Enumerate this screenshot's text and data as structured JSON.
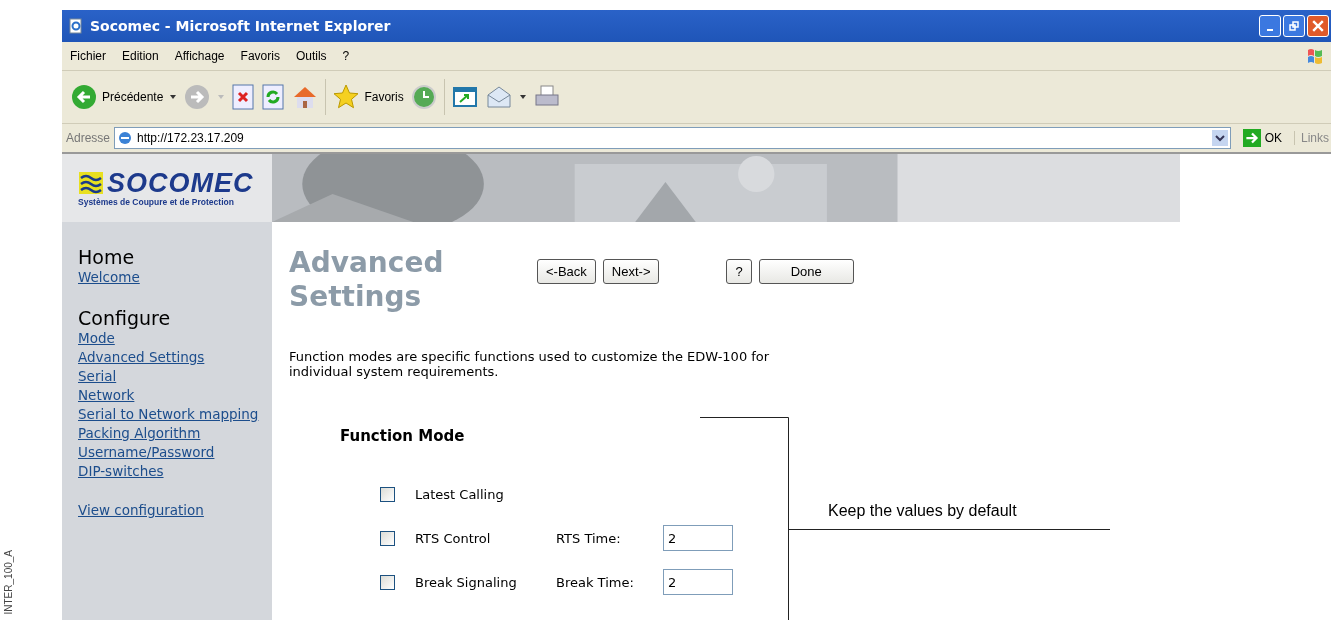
{
  "window": {
    "title": "Socomec - Microsoft Internet Explorer"
  },
  "menu": [
    "Fichier",
    "Edition",
    "Affichage",
    "Favoris",
    "Outils",
    "?"
  ],
  "toolbar": {
    "back": "Précédente",
    "favorites": "Favoris"
  },
  "address": {
    "label": "Adresse",
    "value": "http://172.23.17.209",
    "go": "OK",
    "links": "Links"
  },
  "banner": {
    "logo": "SOCOMEC",
    "tagline": "Systèmes de Coupure et de Protection"
  },
  "sidebar": {
    "sections": [
      {
        "heading": "Home",
        "links": [
          "Welcome"
        ]
      },
      {
        "heading": "Configure",
        "links": [
          "Mode",
          "Advanced Settings",
          "Serial",
          "Network",
          "Serial to Network mapping",
          "Packing Algorithm",
          "Username/Password",
          "DIP-switches"
        ]
      },
      {
        "links": [
          "View configuration"
        ]
      }
    ]
  },
  "page": {
    "title": "Advanced Settings",
    "nav_buttons": [
      "<-Back",
      "Next->"
    ],
    "help_button": "?",
    "done_button": "Done",
    "description": "Function modes are specific functions used to customize the EDW-100 for individual system requirements.",
    "section_title": "Function Mode",
    "options": [
      {
        "label": "Latest Calling",
        "checked": false
      },
      {
        "label": "RTS Control",
        "checked": false,
        "field_label": "RTS Time:",
        "value": "2"
      },
      {
        "label": "Break Signaling",
        "checked": false,
        "field_label": "Break Time:",
        "value": "2"
      }
    ]
  },
  "annotation": "Keep the values by default",
  "side_label": "INTER_100_A"
}
